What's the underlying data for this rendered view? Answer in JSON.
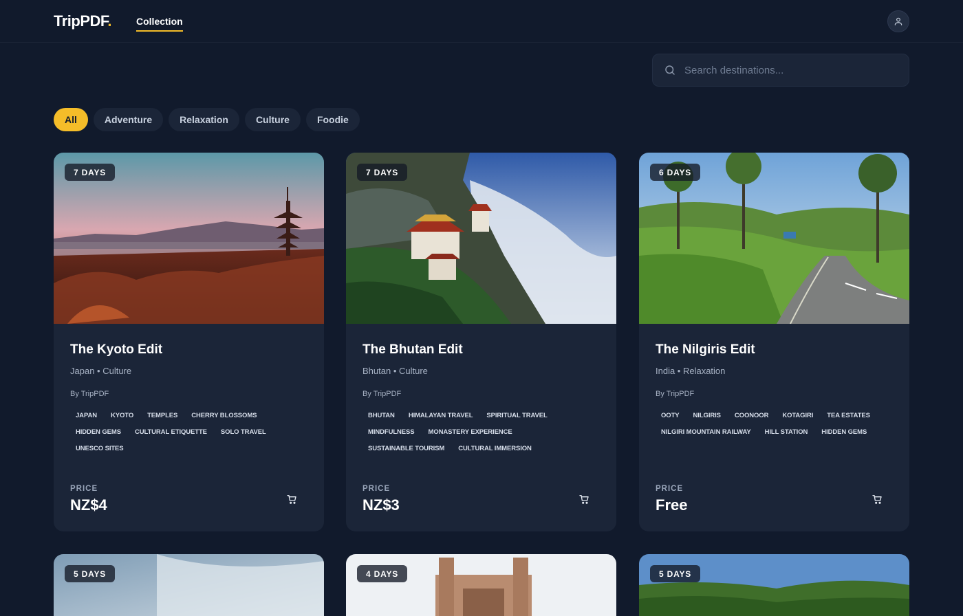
{
  "app": {
    "logo_text": "TripPDF",
    "logo_dot": "."
  },
  "nav": {
    "collection_tab": "Collection"
  },
  "search": {
    "placeholder": "Search destinations..."
  },
  "filters": [
    "All",
    "Adventure",
    "Relaxation",
    "Culture",
    "Foodie"
  ],
  "active_filter": "All",
  "colors": {
    "accent": "#f5bd29",
    "background": "#111a2c",
    "card": "#1b2538"
  },
  "icons": {
    "avatar": "user-icon",
    "search": "search-icon",
    "cart": "cart-icon"
  },
  "cards": [
    {
      "badge": "7 DAYS",
      "title": "The Kyoto Edit",
      "subtitle": "Japan • Culture",
      "author": "By TripPDF",
      "tags": [
        "JAPAN",
        "KYOTO",
        "TEMPLES",
        "CHERRY BLOSSOMS",
        "HIDDEN GEMS",
        "CULTURAL ETIQUETTE",
        "SOLO TRAVEL",
        "UNESCO SITES"
      ],
      "price_label": "PRICE",
      "price": "NZ$4"
    },
    {
      "badge": "7 DAYS",
      "title": "The Bhutan Edit",
      "subtitle": "Bhutan • Culture",
      "author": "By TripPDF",
      "tags": [
        "BHUTAN",
        "HIMALAYAN TRAVEL",
        "SPIRITUAL TRAVEL",
        "MINDFULNESS",
        "MONASTERY EXPERIENCE",
        "SUSTAINABLE TOURISM",
        "CULTURAL IMMERSION"
      ],
      "price_label": "PRICE",
      "price": "NZ$3"
    },
    {
      "badge": "6 DAYS",
      "title": "The Nilgiris Edit",
      "subtitle": "India • Relaxation",
      "author": "By TripPDF",
      "tags": [
        "OOTY",
        "NILGIRIS",
        "COONOOR",
        "KOTAGIRI",
        "TEA ESTATES",
        "NILGIRI MOUNTAIN RAILWAY",
        "HILL STATION",
        "HIDDEN GEMS"
      ],
      "price_label": "PRICE",
      "price": "Free"
    }
  ],
  "bottom_cards": [
    {
      "badge": "5 DAYS"
    },
    {
      "badge": "4 DAYS"
    },
    {
      "badge": "5 DAYS"
    }
  ]
}
